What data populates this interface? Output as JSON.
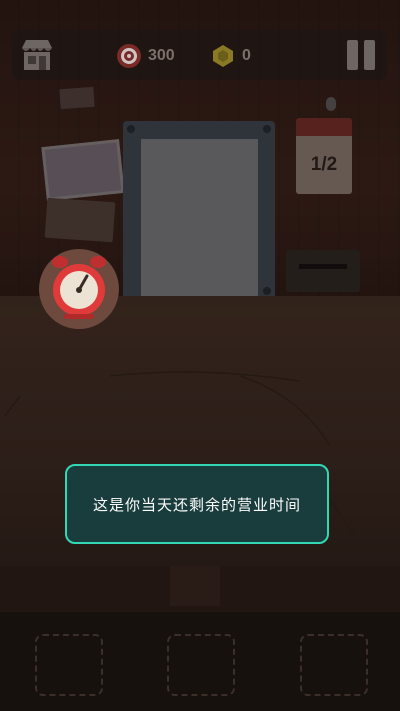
{
  "hud": {
    "target_value": "300",
    "coin_value": "0",
    "shop_icon": "shop-icon",
    "target_icon": "target-icon",
    "coin_icon": "coin-icon",
    "pause_icon": "pause-icon"
  },
  "calendar": {
    "day_label": "1/2"
  },
  "tooltip": {
    "message": "这是你当天还剩余的营业时间"
  },
  "colors": {
    "tooltip_border": "#35d6b4",
    "tooltip_bg": "#193c3d",
    "clock_red": "#e03a3a"
  }
}
